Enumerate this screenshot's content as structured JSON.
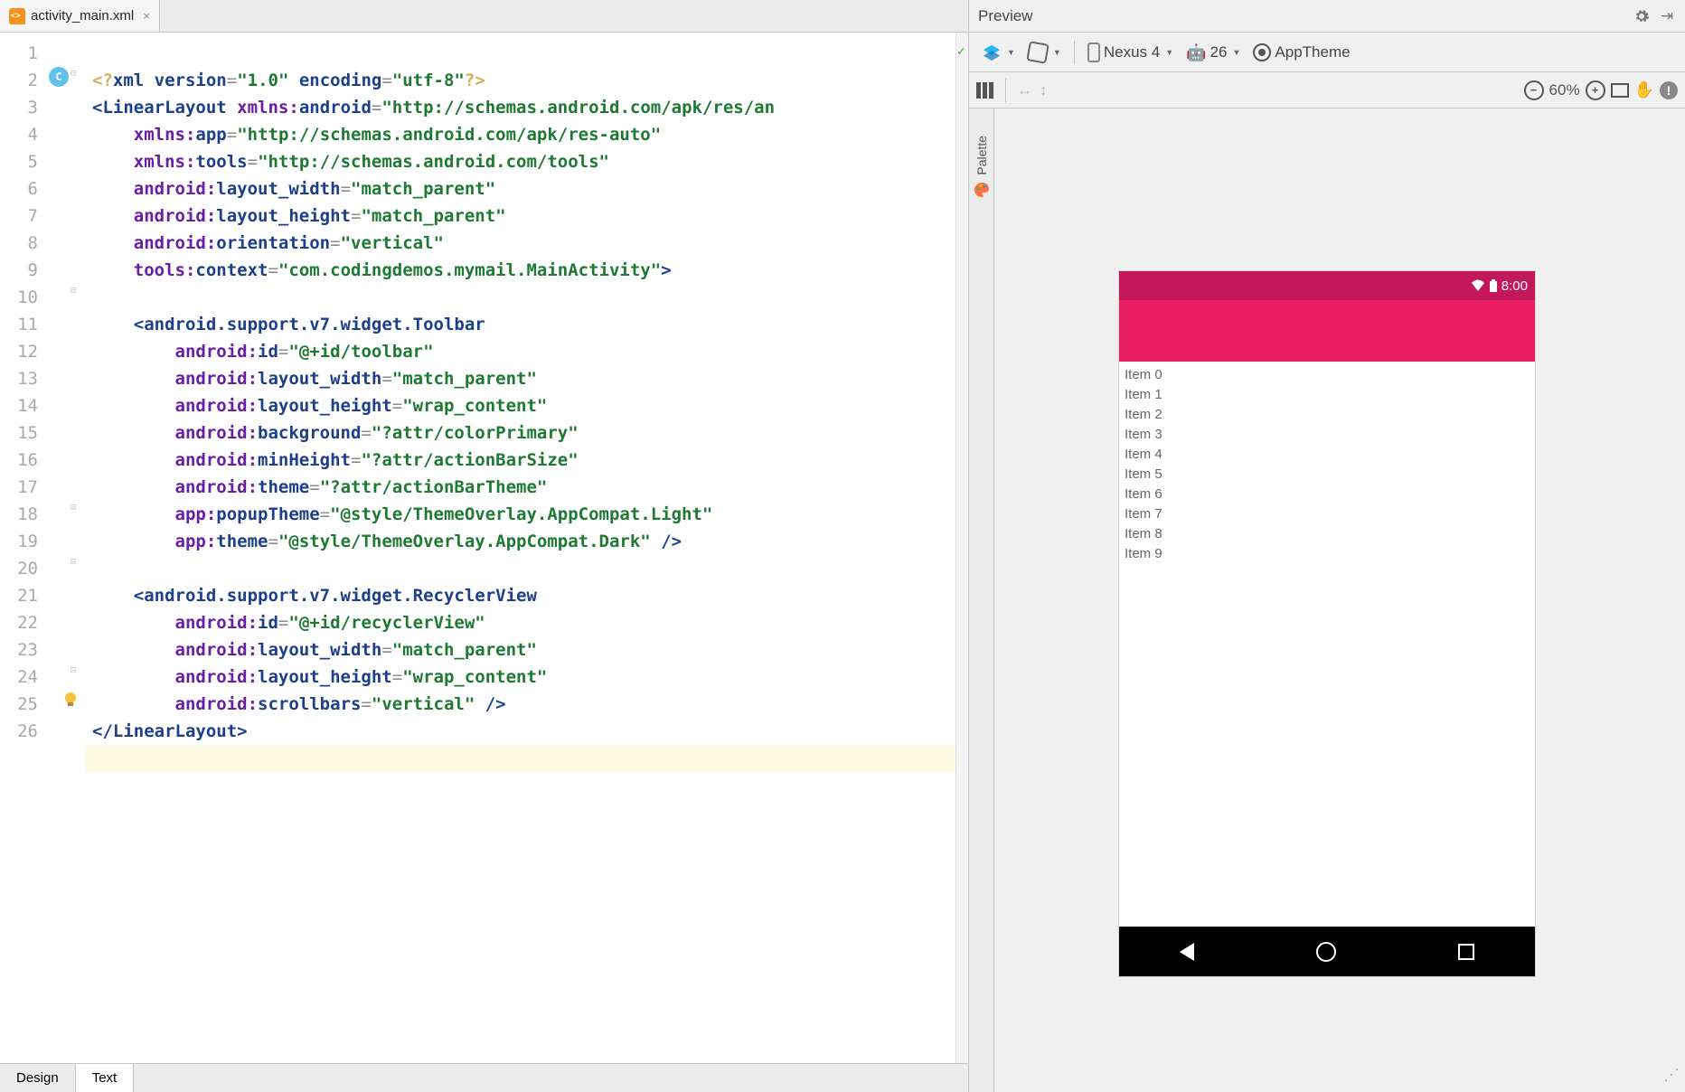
{
  "file_tab": {
    "label": "activity_main.xml"
  },
  "bottom_tabs": {
    "design": "Design",
    "text": "Text"
  },
  "gutter": {
    "lines": [
      "1",
      "2",
      "3",
      "4",
      "5",
      "6",
      "7",
      "8",
      "9",
      "10",
      "11",
      "12",
      "13",
      "14",
      "15",
      "16",
      "17",
      "18",
      "19",
      "20",
      "21",
      "22",
      "23",
      "24",
      "25",
      "26"
    ],
    "c_marker_line": 2,
    "bulb_line": 25
  },
  "code": {
    "l1": {
      "a": "<?",
      "b": "xml version",
      "c": "=",
      "d": "\"1.0\"",
      "e": " encoding",
      "f": "=",
      "g": "\"utf-8\"",
      "h": "?>"
    },
    "l2": {
      "a": "<",
      "b": "LinearLayout ",
      "c": "xmlns:",
      "d": "android",
      "e": "=",
      "f": "\"http://schemas.android.com/apk/res/an"
    },
    "l3": {
      "a": "xmlns:",
      "b": "app",
      "c": "=",
      "d": "\"http://schemas.android.com/apk/res-auto\""
    },
    "l4": {
      "a": "xmlns:",
      "b": "tools",
      "c": "=",
      "d": "\"http://schemas.android.com/tools\""
    },
    "l5": {
      "a": "android:",
      "b": "layout_width",
      "c": "=",
      "d": "\"match_parent\""
    },
    "l6": {
      "a": "android:",
      "b": "layout_height",
      "c": "=",
      "d": "\"match_parent\""
    },
    "l7": {
      "a": "android:",
      "b": "orientation",
      "c": "=",
      "d": "\"vertical\""
    },
    "l8": {
      "a": "tools:",
      "b": "context",
      "c": "=",
      "d": "\"com.codingdemos.mymail.MainActivity\"",
      "e": ">"
    },
    "l10": {
      "a": "<",
      "b": "android.support.v7.widget.Toolbar"
    },
    "l11": {
      "a": "android:",
      "b": "id",
      "c": "=",
      "d": "\"@+id/toolbar\""
    },
    "l12": {
      "a": "android:",
      "b": "layout_width",
      "c": "=",
      "d": "\"match_parent\""
    },
    "l13": {
      "a": "android:",
      "b": "layout_height",
      "c": "=",
      "d": "\"wrap_content\""
    },
    "l14": {
      "a": "android:",
      "b": "background",
      "c": "=",
      "d": "\"?attr/colorPrimary\""
    },
    "l15": {
      "a": "android:",
      "b": "minHeight",
      "c": "=",
      "d": "\"?attr/actionBarSize\""
    },
    "l16": {
      "a": "android:",
      "b": "theme",
      "c": "=",
      "d": "\"?attr/actionBarTheme\""
    },
    "l17": {
      "a": "app:",
      "b": "popupTheme",
      "c": "=",
      "d": "\"@style/ThemeOverlay.AppCompat.Light\""
    },
    "l18": {
      "a": "app:",
      "b": "theme",
      "c": "=",
      "d": "\"@style/ThemeOverlay.AppCompat.Dark\"",
      "e": " />"
    },
    "l20": {
      "a": "<",
      "b": "android.support.v7.widget.RecyclerView"
    },
    "l21": {
      "a": "android:",
      "b": "id",
      "c": "=",
      "d": "\"@+id/recyclerView\""
    },
    "l22": {
      "a": "android:",
      "b": "layout_width",
      "c": "=",
      "d": "\"match_parent\""
    },
    "l23": {
      "a": "android:",
      "b": "layout_height",
      "c": "=",
      "d": "\"wrap_content\""
    },
    "l24": {
      "a": "android:",
      "b": "scrollbars",
      "c": "=",
      "d": "\"vertical\"",
      "e": " />"
    },
    "l25a": "</",
    "l25b": "LinearLayout",
    "l25c": ">"
  },
  "palette": {
    "label": "Palette"
  },
  "preview": {
    "title": "Preview",
    "device_label": "Nexus 4",
    "api_label": "26",
    "theme_label": "AppTheme",
    "zoom": "60%",
    "status_time": "8:00",
    "items": [
      "Item 0",
      "Item 1",
      "Item 2",
      "Item 3",
      "Item 4",
      "Item 5",
      "Item 6",
      "Item 7",
      "Item 8",
      "Item 9"
    ]
  }
}
